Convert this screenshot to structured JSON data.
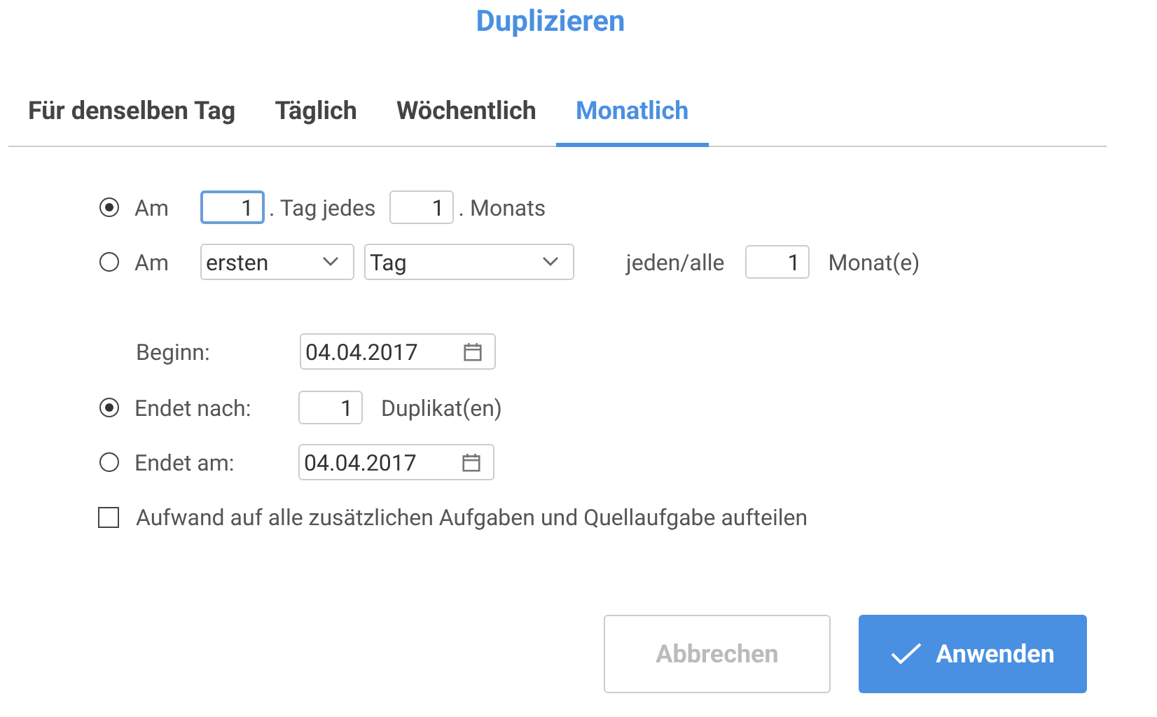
{
  "title": "Duplizieren",
  "tabs": [
    {
      "label": "Für denselben Tag",
      "selected": false
    },
    {
      "label": "Täglich",
      "selected": false
    },
    {
      "label": "Wöchentlich",
      "selected": false
    },
    {
      "label": "Monatlich",
      "selected": true
    }
  ],
  "monthly_options": [
    {
      "kind": "day_of_month",
      "selected": true,
      "label": "Am",
      "day": "1",
      "day_focused": true,
      "text_1": ". Tag jedes",
      "months": "1",
      "text_2": ". Monats"
    },
    {
      "kind": "weekday",
      "selected": false,
      "label": "Am",
      "ordinal": "ersten",
      "unit": "Tag",
      "text_1": "jeden/alle",
      "months": "1",
      "text_2": "Monat(e)"
    }
  ],
  "start": {
    "label": "Beginn:",
    "date": "04.04.2017"
  },
  "end_options": [
    {
      "kind": "count",
      "selected": true,
      "label": "Endet nach:",
      "value": "1",
      "suffix": "Duplikat(en)"
    },
    {
      "kind": "date",
      "selected": false,
      "label": "Endet am:",
      "value": "04.04.2017"
    }
  ],
  "split_effort": {
    "label": "Aufwand auf alle zusätzlichen Aufgaben und Quellaufgabe aufteilen",
    "checked": false
  },
  "buttons": [
    {
      "kind": "secondary",
      "label": "Abbrechen"
    },
    {
      "kind": "primary",
      "label": "Anwenden"
    }
  ]
}
